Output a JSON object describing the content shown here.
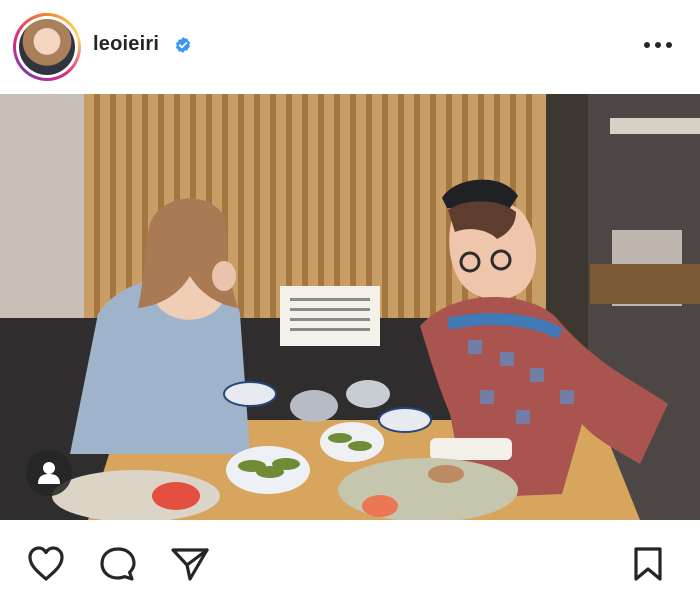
{
  "post": {
    "username": "leoieiri",
    "verified": true
  },
  "icons": {
    "avatar": "profile-photo",
    "verified": "verified-badge-icon",
    "more": "more-options-icon",
    "tag": "user-tag-icon",
    "like": "heart-icon",
    "comment": "comment-icon",
    "share": "send-icon",
    "save": "bookmark-icon"
  },
  "colors": {
    "text": "#262626",
    "verified_blue": "#3897f0"
  }
}
